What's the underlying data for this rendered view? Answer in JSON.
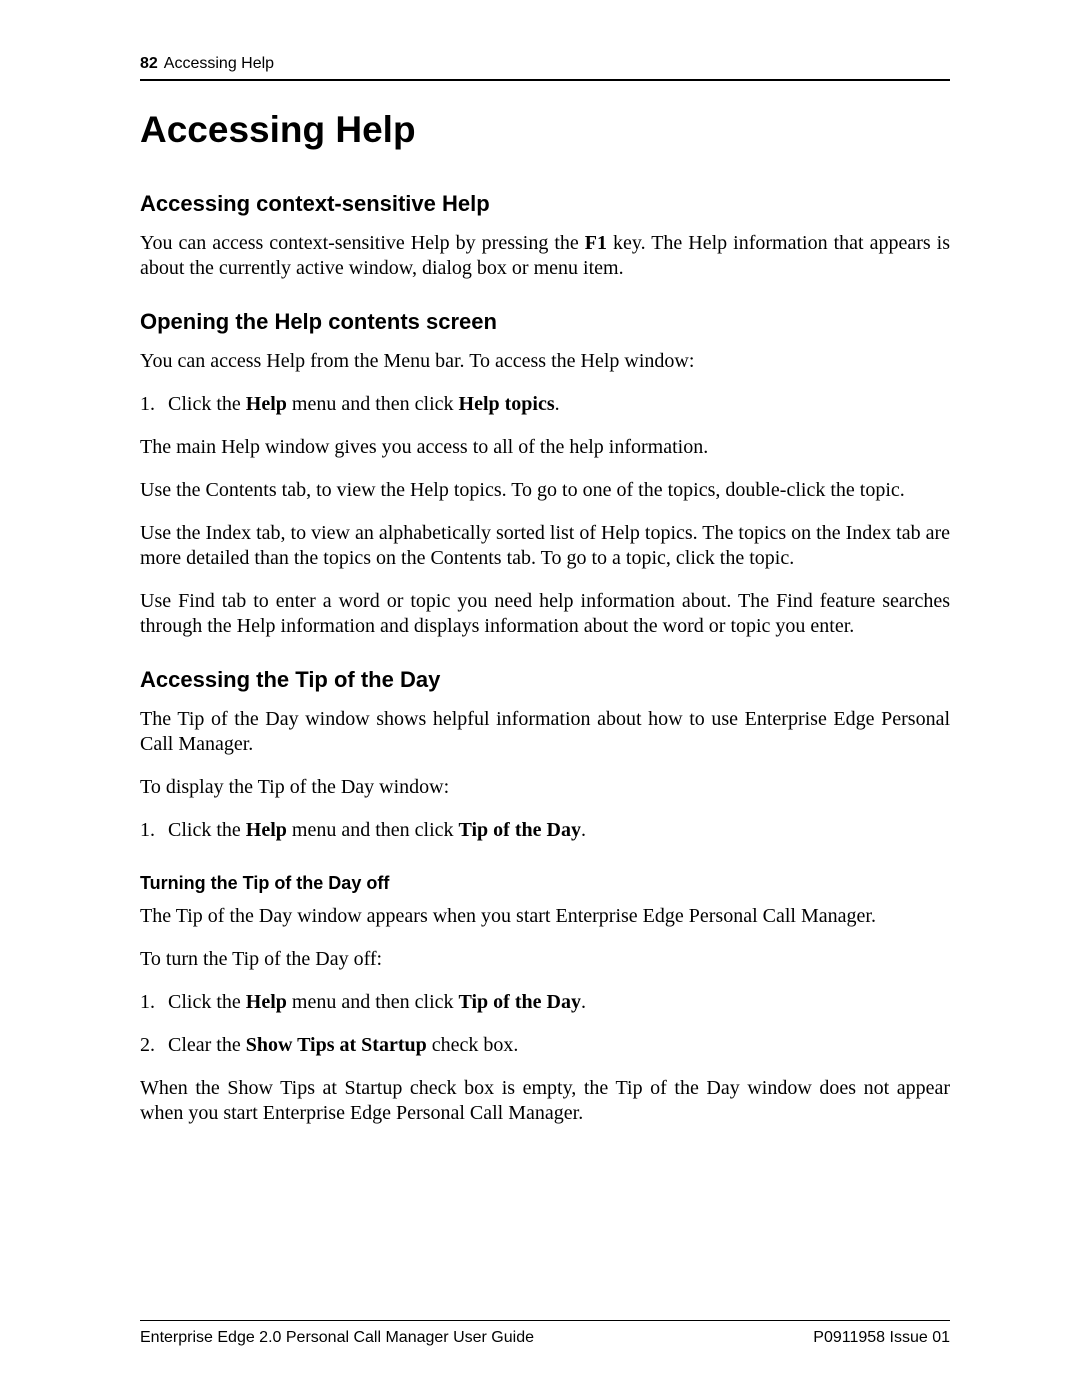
{
  "header": {
    "page_no": "82",
    "running_title": "Accessing Help"
  },
  "title": "Accessing Help",
  "sections": [
    {
      "heading": "Accessing context-sensitive Help",
      "paras": [
        {
          "runs": [
            {
              "t": "You can access context-sensitive Help by pressing the "
            },
            {
              "t": "F1",
              "b": true
            },
            {
              "t": " key. The Help information that appears is about the currently active window, dialog box or menu item."
            }
          ]
        }
      ]
    },
    {
      "heading": "Opening the Help contents screen",
      "paras": [
        {
          "runs": [
            {
              "t": "You can access Help from the Menu bar. To access the Help window:"
            }
          ]
        },
        {
          "list_no": "1.",
          "runs": [
            {
              "t": "Click the "
            },
            {
              "t": "Help",
              "b": true
            },
            {
              "t": " menu and then click "
            },
            {
              "t": "Help topics",
              "b": true
            },
            {
              "t": "."
            }
          ]
        },
        {
          "runs": [
            {
              "t": "The main Help window gives you access to all of the help information."
            }
          ]
        },
        {
          "runs": [
            {
              "t": "Use the Contents tab, to view the Help topics. To go to one of the topics, double-click the topic."
            }
          ]
        },
        {
          "runs": [
            {
              "t": "Use the Index tab, to view an alphabetically sorted list of Help topics. The topics on the Index tab are more detailed than the topics on the Contents tab. To go to a topic, click the topic."
            }
          ]
        },
        {
          "runs": [
            {
              "t": "Use Find tab to enter a word or topic you need help information about. The Find feature searches through the Help information and displays information about the word or topic you enter."
            }
          ]
        }
      ]
    },
    {
      "heading": "Accessing the Tip of the Day",
      "paras": [
        {
          "runs": [
            {
              "t": "The Tip of the Day window shows helpful information about how to use Enterprise Edge Personal Call Manager."
            }
          ]
        },
        {
          "runs": [
            {
              "t": "To display the Tip of the Day window:"
            }
          ]
        },
        {
          "list_no": "1.",
          "runs": [
            {
              "t": "Click the "
            },
            {
              "t": "Help",
              "b": true
            },
            {
              "t": " menu and then click "
            },
            {
              "t": "Tip of the Day",
              "b": true
            },
            {
              "t": "."
            }
          ]
        }
      ],
      "sub": {
        "heading": "Turning the Tip of the Day off",
        "paras": [
          {
            "runs": [
              {
                "t": "The Tip of the Day window appears when you start Enterprise Edge Personal Call Manager."
              }
            ]
          },
          {
            "runs": [
              {
                "t": "To turn the Tip of the Day off:"
              }
            ]
          },
          {
            "list_no": "1.",
            "runs": [
              {
                "t": "Click the "
              },
              {
                "t": "Help",
                "b": true
              },
              {
                "t": " menu and then click "
              },
              {
                "t": "Tip of the Day",
                "b": true
              },
              {
                "t": "."
              }
            ]
          },
          {
            "list_no": "2.",
            "runs": [
              {
                "t": "Clear the "
              },
              {
                "t": "Show Tips at Startup",
                "b": true
              },
              {
                "t": " check box."
              }
            ]
          },
          {
            "runs": [
              {
                "t": "When the Show Tips at Startup check box is empty, the Tip of the Day window does not appear when you start Enterprise Edge Personal Call Manager."
              }
            ]
          }
        ]
      }
    }
  ],
  "footer": {
    "left": "Enterprise Edge 2.0 Personal Call Manager User Guide",
    "right": "P0911958 Issue 01"
  }
}
